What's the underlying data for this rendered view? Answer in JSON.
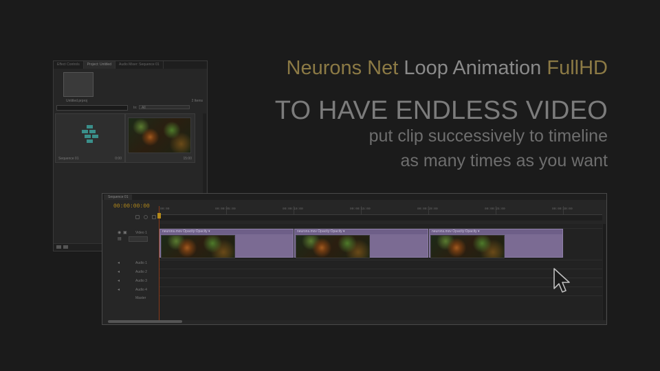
{
  "headline": {
    "part1": "Neurons Net",
    "part2": "Loop Animation",
    "part3": "FullHD",
    "big": "TO HAVE ENDLESS VIDEO",
    "sub1": "put clip successively to timeline",
    "sub2": "as many times as you want"
  },
  "project_panel": {
    "tabs": [
      "Effect Controls",
      "Project: Untitled",
      "Audio Mixer: Sequence 01"
    ],
    "project_name": "Untitled.prproj",
    "item_count": "2 Items",
    "in_label": "In:",
    "in_value": "All",
    "bins": [
      {
        "label": "Sequence 01",
        "duration": "0:00"
      },
      {
        "label": "",
        "duration": "15:00"
      }
    ]
  },
  "timeline": {
    "tab": "Sequence 01",
    "timecode": "00:00:00:00",
    "ruler_ticks": [
      "00:00",
      "00:00:05:00",
      "00:00:10:00",
      "00:00:15:00",
      "00:00:20:00",
      "00:00:25:00",
      "00:00:30:00"
    ],
    "tracks": {
      "video1": "Video 1",
      "audio": [
        "Audio 1",
        "Audio 2",
        "Audio 3",
        "Audio 4"
      ],
      "master": "Master"
    },
    "clips": [
      {
        "name": "neurons.mov  Opacity:Opacity ▾"
      },
      {
        "name": "neurons.mov  Opacity:Opacity ▾"
      },
      {
        "name": "neurons.mov  Opacity:Opacity ▾"
      }
    ]
  },
  "colors": {
    "accent_gold": "#8c7a45",
    "timecode": "#b48a1a",
    "clip": "#7b6b93"
  },
  "icons": [
    "arrow-cursor-icon",
    "sequence-icon",
    "eye-icon",
    "speaker-icon",
    "lock-icon"
  ]
}
